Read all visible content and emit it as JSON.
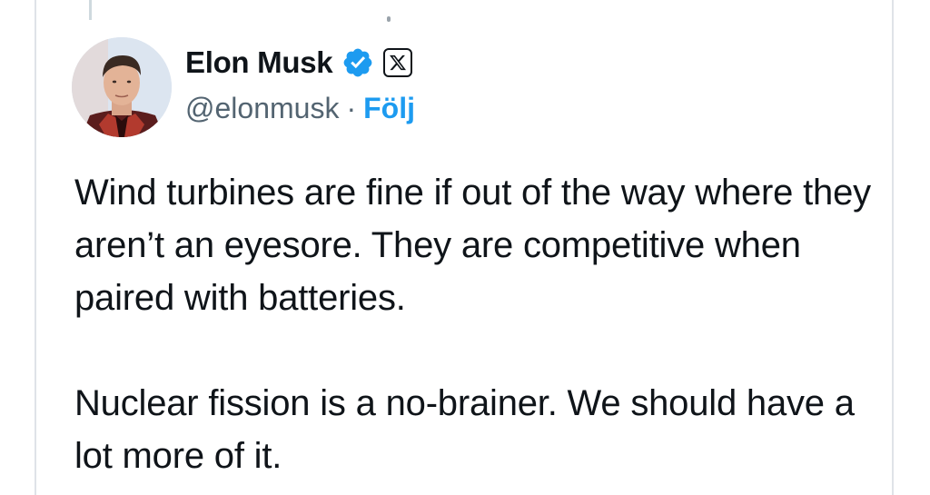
{
  "tweet": {
    "author": {
      "display_name": "Elon Musk",
      "handle": "@elonmusk",
      "separator": "·",
      "follow_label": "Följ",
      "verified_icon": "verified-badge-icon",
      "affiliate_icon": "x-logo-icon"
    },
    "paragraphs": [
      "Wind turbines are fine if out of the way where they aren’t an eyesore. They are competitive when paired with batteries.",
      "Nuclear fission is a no-brainer. We should have a lot more of it."
    ]
  },
  "colors": {
    "link": "#1d9bf0",
    "verified": "#1d9bf0",
    "text": "#0f1419",
    "secondary": "#536471",
    "border": "#dfe3e8"
  }
}
